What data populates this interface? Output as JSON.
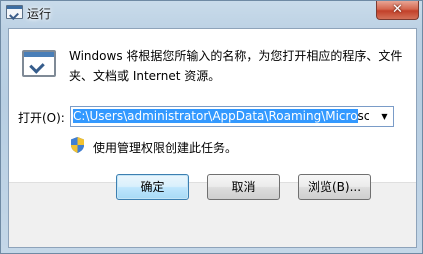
{
  "window": {
    "title": "运行",
    "close_glyph": "✕"
  },
  "dialog": {
    "description": "Windows 将根据您所输入的名称，为您打开相应的程序、文件夹、文档或 Internet 资源。",
    "open_label": "打开(O):",
    "input_value_selected": "C:\\Users\\administrator\\AppData\\Roaming\\Micro",
    "input_value_rest": "sc",
    "admin_note": "使用管理权限创建此任务。"
  },
  "buttons": {
    "ok": "确定",
    "cancel": "取消",
    "browse": "浏览(B)..."
  },
  "icons": {
    "title": "run-dialog-icon",
    "main": "run-program-icon",
    "shield": "uac-shield-icon",
    "dropdown": "chevron-down-icon"
  },
  "colors": {
    "selection": "#3399ff",
    "default_button_border": "#3c7fb1",
    "close_button": "#c2412a"
  }
}
